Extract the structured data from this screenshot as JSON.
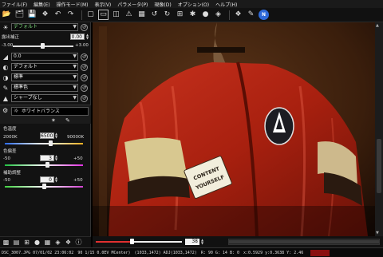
{
  "menu": [
    "ファイル(F)",
    "編集(E)",
    "操作モード(M)",
    "表示(V)",
    "パラメータ(P)",
    "現像(D)",
    "オプション(O)",
    "ヘルプ(H)"
  ],
  "panel": {
    "picture_control": "デフォルト",
    "exposure_label": "露出補正",
    "exposure_value": "0.00",
    "exposure_min": "-3.00",
    "exposure_max": "+3.00",
    "tone_value": "0.0",
    "contrast": "デフォルト",
    "saturation": "標準",
    "color": "標準色",
    "sharpness": "シャープなし"
  },
  "white_balance": {
    "tab_label": "ホワイトバランス",
    "temp_label": "色温度",
    "temp_min": "2000K",
    "temp_value": "6500",
    "temp_max": "90000K",
    "tint_label": "色偏差",
    "tint_min": "-50",
    "tint_value": "3",
    "tint_max": "+50",
    "fine_label": "補助調整",
    "fine_min": "-50",
    "fine_value": "0",
    "fine_max": "+50"
  },
  "zoom": {
    "value": "38",
    "fraction": 0.42
  },
  "status": {
    "file": "DSC_3007.JPG 07/01/02 23:06:02",
    "shot": "90 1/15 0.0EV MCenter)",
    "pos": "(1033,1472) ADJ(1033,1472)",
    "rgb": "R: 90 G: 14 B: 0",
    "xyz": "x:0.5929 y:0.3638 Y: 2.46"
  },
  "photo": {
    "badge_lines": [
      "CONTENT",
      "YOURSELF"
    ]
  }
}
